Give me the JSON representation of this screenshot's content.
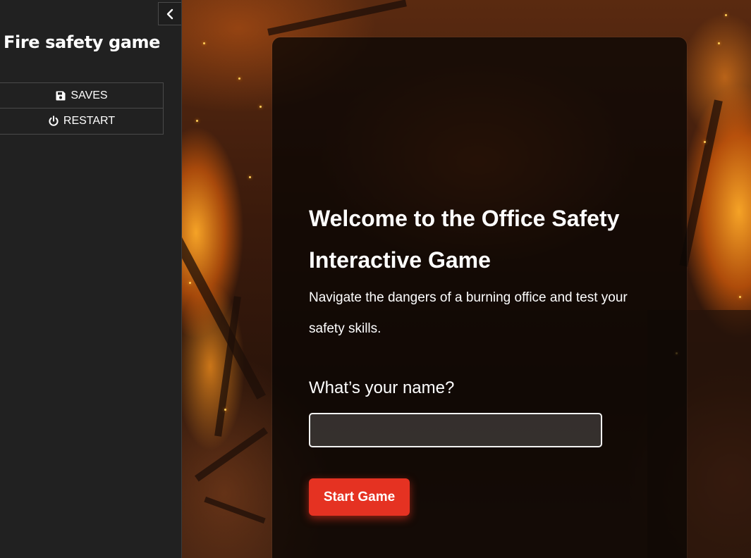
{
  "sidebar": {
    "title": "Fire safety game",
    "collapse_icon": "chevron-left-icon",
    "menu": {
      "saves": {
        "label": "SAVES",
        "icon": "floppy-disk-icon"
      },
      "restart": {
        "label": "RESTART",
        "icon": "power-icon"
      }
    }
  },
  "welcome": {
    "title": "Welcome to the Office Safety Interactive Game",
    "description": "Navigate the dangers of a burning office and test your safety skills.",
    "name_prompt": "What’s your name?",
    "name_value": "",
    "start_label": "Start Game"
  },
  "colors": {
    "sidebar_bg": "#212121",
    "accent": "#e53222",
    "card_bg": "#0a0604"
  }
}
